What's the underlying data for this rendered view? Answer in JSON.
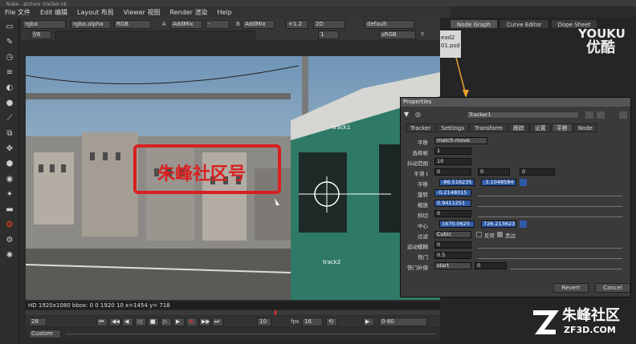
{
  "window_title": "Nuke - picture_tracker.nk",
  "menu": [
    "File 文件",
    "Edit 编辑",
    "Layout 布局",
    "Viewer 视图",
    "Render 渲染",
    "Help"
  ],
  "viewer_controls": {
    "channels": "rgba",
    "alpha": "rgba.alpha",
    "colorspace": "RGB",
    "a_label": "A",
    "a_input": "AddMix",
    "a_value": "-",
    "b_label": "B",
    "b_input": "AddMix",
    "gain": "+1.2",
    "mode": "2D",
    "lut": "default",
    "fstop_label": "f/8",
    "frame": "1",
    "frame_label": "1",
    "output": "sRGB",
    "y_label": "Y",
    "y_value": "1"
  },
  "status_text": "HD 1920x1080 bbox: 0 0 1920 10  x=1454 y= 718",
  "transport": {
    "frame": "28",
    "step": "10",
    "fps_label": "fps",
    "fps": "16",
    "range": "0-80",
    "playback": "Custom"
  },
  "right_tabs": [
    "Node Graph",
    "Curve Editor",
    "Dope Sheet"
  ],
  "node_graph": {
    "node_line1": "ead2",
    "node_line2": "01.psd"
  },
  "watermark": {
    "youku_top": "YOUKU",
    "youku_bottom": "优酷",
    "zf_top": "朱峰社区",
    "zf_bottom": "ZF3D.COM"
  },
  "overlay_text": "朱峰社区号",
  "track_labels": [
    "track1",
    "track2"
  ],
  "properties": {
    "title": "Properties",
    "node_name": "Tracker1",
    "tabs": [
      "Tracker",
      "Settings",
      "Transform",
      "跟踪",
      "设置",
      "平移",
      "Node"
    ],
    "active_tab_index": 5,
    "rows": [
      {
        "label": "平移",
        "value": "match-move"
      },
      {
        "label": "选择帧",
        "value": "1"
      },
      {
        "label": "抖动范围",
        "value": "10"
      },
      {
        "label": "平滑 t",
        "t": "0",
        "r": "0",
        "s": "0"
      },
      {
        "label": "平移",
        "x": "-86.516235",
        "y": "-3.1048584"
      },
      {
        "label": "旋转",
        "value": "-0.2148015"
      },
      {
        "label": "缩放",
        "value": "0.9411251"
      },
      {
        "label": "斜切",
        "value": "0"
      },
      {
        "label": "中心",
        "x": "1670.0625",
        "y": "726.213623"
      },
      {
        "label": "过滤",
        "value": "Cubic",
        "opt1": "反转",
        "opt2": "黑边"
      },
      {
        "label": "运动模糊",
        "value": "0"
      },
      {
        "label": "快门",
        "value": "0.5"
      },
      {
        "label": "快门补偿",
        "value": "start",
        "value2": "0"
      }
    ],
    "revert_label": "Revert",
    "cancel_label": "Cancel"
  }
}
